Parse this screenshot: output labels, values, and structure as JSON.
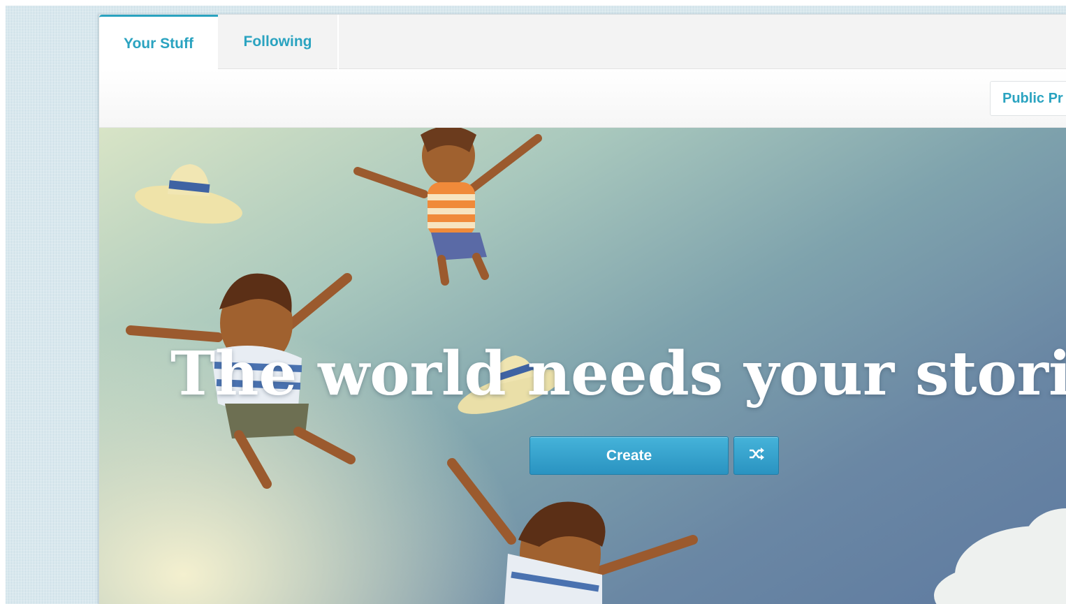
{
  "tabs": [
    {
      "label": "Your Stuff",
      "active": true
    },
    {
      "label": "Following",
      "active": false
    }
  ],
  "toolbar": {
    "public_profile_label": "Public Pr"
  },
  "hero": {
    "headline": "The world needs your stori",
    "create_label": "Create",
    "shuffle_icon": "shuffle-icon"
  },
  "colors": {
    "accent": "#2aa3c0",
    "button": "#3aa7d2",
    "headline": "#ffffff"
  }
}
